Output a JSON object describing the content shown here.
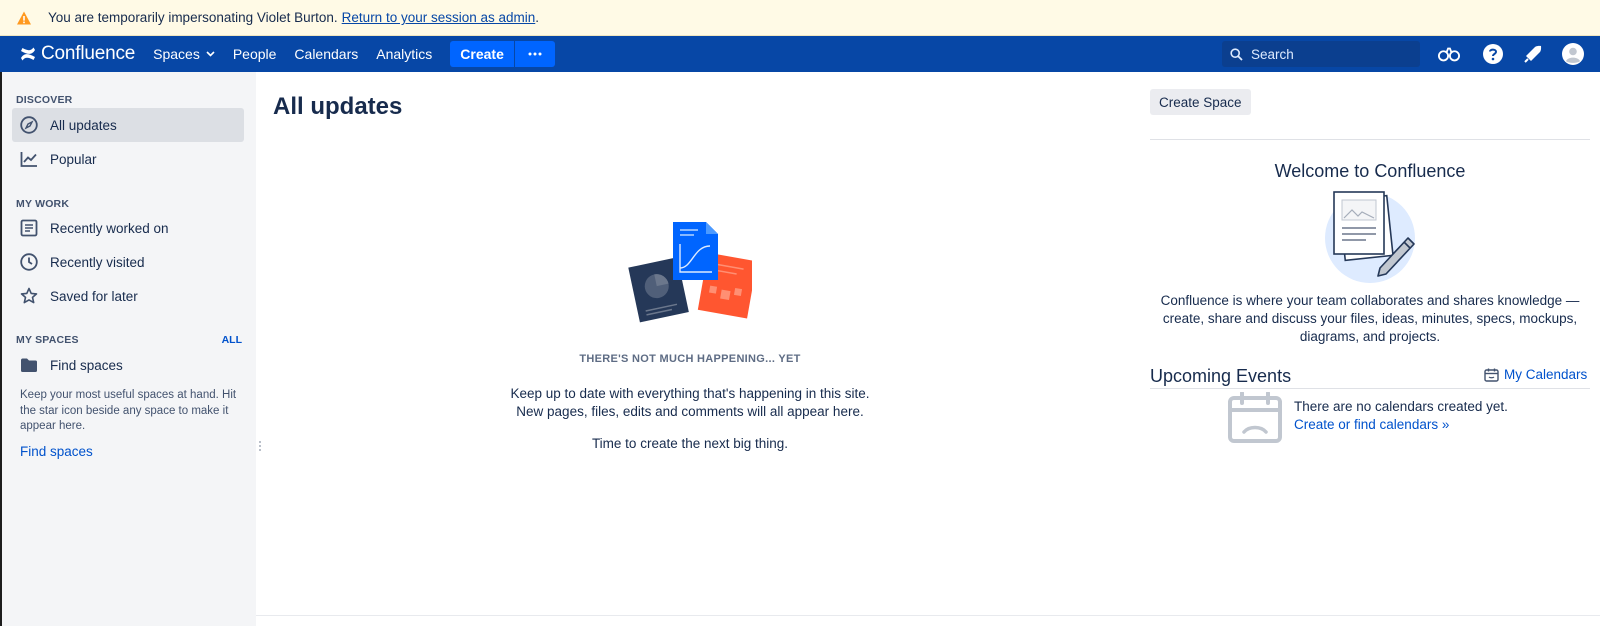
{
  "banner": {
    "message": "You are temporarily impersonating Violet Burton.",
    "link": "Return to your session as admin",
    "suffix": "."
  },
  "topnav": {
    "logo": "Confluence",
    "items": [
      "Spaces",
      "People",
      "Calendars",
      "Analytics"
    ],
    "create_label": "Create",
    "search_placeholder": "Search",
    "icons": [
      "binoculars-icon",
      "help-icon",
      "notifications-icon",
      "avatar-icon"
    ]
  },
  "sidebar": {
    "discover_header": "DISCOVER",
    "discover_items": [
      "All updates",
      "Popular"
    ],
    "mywork_header": "MY WORK",
    "mywork_items": [
      "Recently worked on",
      "Recently visited",
      "Saved for later"
    ],
    "myspaces_header": "MY SPACES",
    "myspaces_all": "ALL",
    "find_spaces_item": "Find spaces",
    "note": "Keep your most useful spaces at hand. Hit the star icon beside any space to make it appear here.",
    "find_spaces_link": "Find spaces"
  },
  "main": {
    "title": "All updates",
    "empty_heading": "THERE'S NOT MUCH HAPPENING... YET",
    "empty_line1": "Keep up to date with everything that's happening in this site.",
    "empty_line2": "New pages, files, edits and comments will all appear here.",
    "empty_line3": "Time to create the next big thing."
  },
  "right": {
    "create_space": "Create Space",
    "welcome_title": "Welcome to Confluence",
    "welcome_text": "Confluence is where your team collaborates and shares knowledge — create, share and discuss your files, ideas, minutes, specs, mockups, diagrams, and projects.",
    "events_title": "Upcoming Events",
    "my_calendars": "My Calendars",
    "no_calendars": "There are no calendars created yet.",
    "calendar_link": "Create or find calendars »"
  },
  "colors": {
    "nav_bg": "#0747a6",
    "create_btn": "#0065ff",
    "banner_bg": "#fffae6",
    "sidebar_bg": "#f4f5f7",
    "link": "#0052cc",
    "warning": "#ff991f"
  }
}
